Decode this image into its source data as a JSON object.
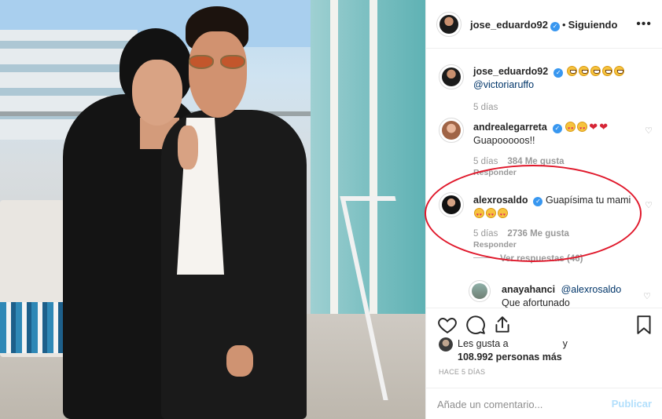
{
  "post": {
    "author": "jose_eduardo92",
    "follow_label": "Siguiendo",
    "more_label": "•••"
  },
  "comments": [
    {
      "user": "jose_eduardo92",
      "verified": true,
      "text_mention": "@victoriaruffo",
      "time": "5 días"
    },
    {
      "user": "andrealegarreta",
      "verified": true,
      "text": "Guapooooos!!",
      "time": "5 días",
      "likes": "384 Me gusta",
      "reply_label": "Responder"
    },
    {
      "user": "alexrosaldo",
      "verified": true,
      "text": "Guapísima tu mami",
      "time": "5 días",
      "likes": "2736 Me gusta",
      "reply_label": "Responder",
      "view_replies": "Ver respuestas (46)"
    },
    {
      "user": "anayahanci",
      "mention": "@alexrosaldo",
      "text": "Que afortunado"
    }
  ],
  "footer": {
    "likes_prefix": "Les gusta a",
    "likes_suffix": "y",
    "likes_count": "108.992 personas más",
    "time_ago": "HACE 5 DÍAS",
    "comment_placeholder": "Añade un comentario...",
    "publish_label": "Publicar"
  },
  "colors": {
    "highlight": "#e0182b",
    "verified": "#3897f0",
    "publish_disabled": "#b2dffc"
  },
  "icons": [
    "heart-icon",
    "comment-icon",
    "share-icon",
    "bookmark-icon",
    "more-icon",
    "verified-badge-icon"
  ]
}
